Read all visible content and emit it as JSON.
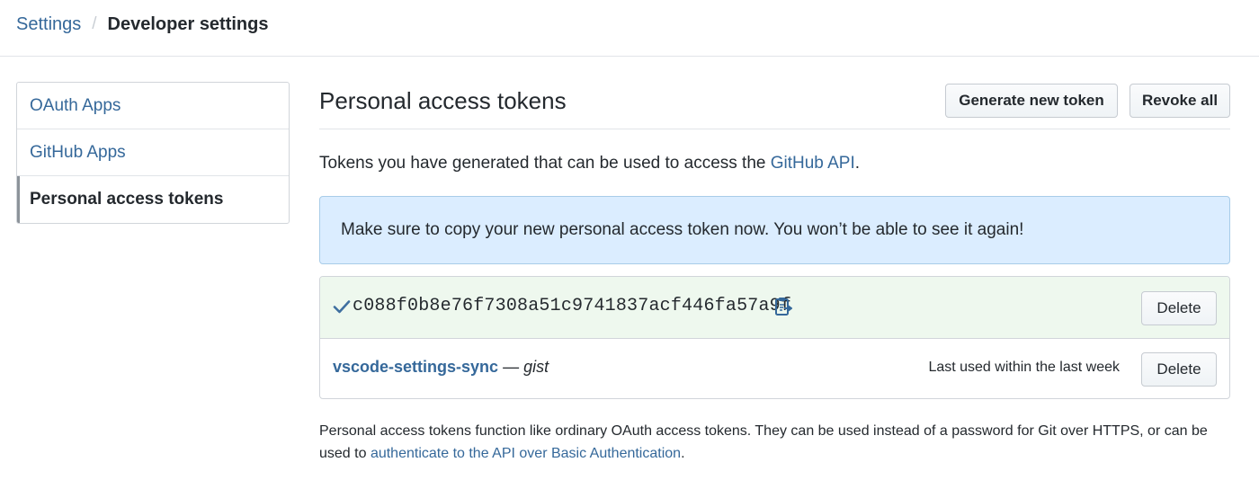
{
  "breadcrumb": {
    "root": "Settings",
    "separator": "/",
    "current": "Developer settings"
  },
  "sidebar": {
    "items": [
      {
        "label": "OAuth Apps",
        "selected": false
      },
      {
        "label": "GitHub Apps",
        "selected": false
      },
      {
        "label": "Personal access tokens",
        "selected": true
      }
    ]
  },
  "header": {
    "title": "Personal access tokens",
    "generate_label": "Generate new token",
    "revoke_label": "Revoke all"
  },
  "intro": {
    "text": "Tokens you have generated that can be used to access the ",
    "link": "GitHub API",
    "end": "."
  },
  "flash": {
    "message": "Make sure to copy your new personal access token now. You won’t be able to see it again!"
  },
  "tokens": {
    "new_token": {
      "value": "c088f0b8e76f7308a51c9741837acf446fa57a9f",
      "delete_label": "Delete",
      "icons": [
        "check-icon",
        "clipboard-icon"
      ]
    },
    "existing": [
      {
        "name": "vscode-settings-sync",
        "separator": "—",
        "scope": "gist",
        "last_used": "Last used within the last week",
        "delete_label": "Delete"
      }
    ]
  },
  "footnote": {
    "text": "Personal access tokens function like ordinary OAuth access tokens. They can be used instead of a password for Git over HTTPS, or can be used to ",
    "link": "authenticate to the API over Basic Authentication",
    "end": "."
  },
  "colors": {
    "link": "#35689a",
    "flash_bg": "#dbedff",
    "new_token_bg": "#eef8ee",
    "check": "#28a745"
  }
}
